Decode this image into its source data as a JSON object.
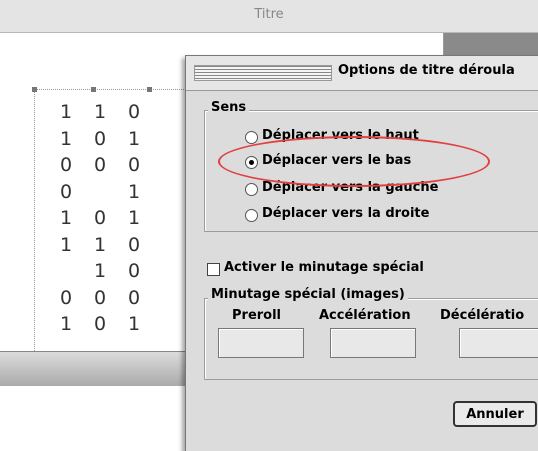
{
  "back_window": {
    "title": "Titre",
    "credits_digits": [
      [
        "1",
        "1",
        "0"
      ],
      [
        "1",
        "0",
        "1"
      ],
      [
        "0",
        "0",
        "0"
      ],
      [
        "0",
        "",
        "1"
      ],
      [
        "1",
        "0",
        "1"
      ],
      [
        "1",
        "1",
        "0"
      ],
      [
        "",
        "1",
        "0"
      ],
      [
        "0",
        "0",
        "0"
      ],
      [
        "1",
        "0",
        "1"
      ]
    ]
  },
  "dialog": {
    "title": "Options de titre déroula",
    "direction_group": {
      "label": "Sens",
      "options": [
        {
          "label": "Déplacer vers le haut",
          "selected": false
        },
        {
          "label": "Déplacer vers le bas",
          "selected": true
        },
        {
          "label": "Déplacer vers la gauche",
          "selected": false
        },
        {
          "label": "Déplacer vers la droite",
          "selected": false
        }
      ]
    },
    "special_timing_checkbox": {
      "label": "Activer le minutage spécial",
      "checked": false
    },
    "timing_group": {
      "label": "Minutage spécial (images)",
      "columns": [
        "Preroll",
        "Accélération",
        "Décélératio"
      ],
      "values": [
        "",
        "",
        ""
      ]
    },
    "cancel_button": "Annuler"
  },
  "colors": {
    "highlight_ellipse": "#e04040",
    "dialog_bg": "#dcdcdc"
  }
}
